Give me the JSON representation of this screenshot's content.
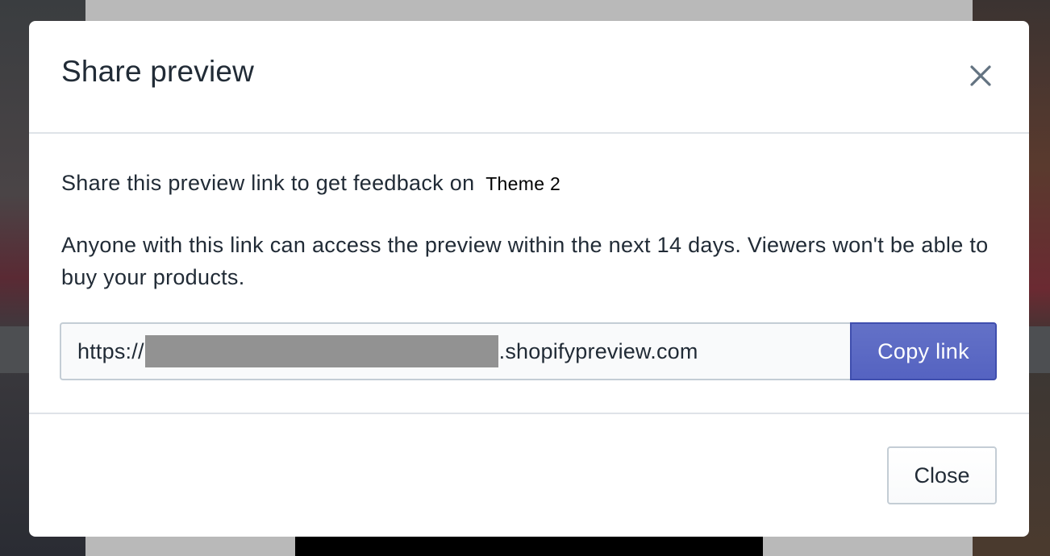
{
  "modal": {
    "title": "Share preview",
    "close_icon": "close-icon",
    "intro_text": "Share this preview link to get feedback on",
    "theme_name": "Theme 2",
    "note_text": "Anyone with this link can access the preview within the next 14 days. Viewers won't be able to buy your products.",
    "link": {
      "prefix": "https://",
      "suffix": ".shopifypreview.com",
      "redacted": true
    },
    "copy_button_label": "Copy link",
    "close_button_label": "Close"
  },
  "colors": {
    "primary_button": "#5c6ac4",
    "text": "#212b36",
    "divider": "#dfe3e8",
    "field_border": "#c4cdd5",
    "redaction": "#929292"
  }
}
